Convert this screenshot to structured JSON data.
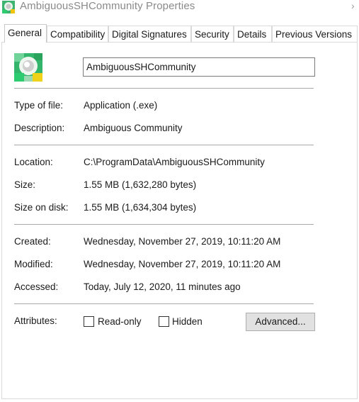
{
  "window": {
    "title": "AmbiguousSHCommunity Properties",
    "overflow_glyph": "›"
  },
  "tabs": [
    {
      "label": "General",
      "active": true
    },
    {
      "label": "Compatibility"
    },
    {
      "label": "Digital Signatures"
    },
    {
      "label": "Security"
    },
    {
      "label": "Details"
    },
    {
      "label": "Previous Versions"
    }
  ],
  "file": {
    "name": "AmbiguousSHCommunity",
    "icon": "app-file-icon"
  },
  "fields": {
    "type_label": "Type of file:",
    "type_value": "Application (.exe)",
    "description_label": "Description:",
    "description_value": "Ambiguous Community",
    "location_label": "Location:",
    "location_value": "C:\\ProgramData\\AmbiguousSHCommunity",
    "size_label": "Size:",
    "size_value": "1.55 MB (1,632,280 bytes)",
    "size_on_disk_label": "Size on disk:",
    "size_on_disk_value": "1.55 MB (1,634,304 bytes)",
    "created_label": "Created:",
    "created_value": "Wednesday, November 27, 2019, 10:11:20 AM",
    "modified_label": "Modified:",
    "modified_value": "Wednesday, November 27, 2019, 10:11:20 AM",
    "accessed_label": "Accessed:",
    "accessed_value": "Today, July 12, 2020, 11 minutes ago"
  },
  "attributes": {
    "label": "Attributes:",
    "read_only_label": "Read-only",
    "read_only_checked": false,
    "hidden_label": "Hidden",
    "hidden_checked": false,
    "advanced_label": "Advanced..."
  },
  "colors": {
    "title_text": "#8a8a8a",
    "separator": "#a8a8a8",
    "button_bg": "#e1e1e1"
  }
}
